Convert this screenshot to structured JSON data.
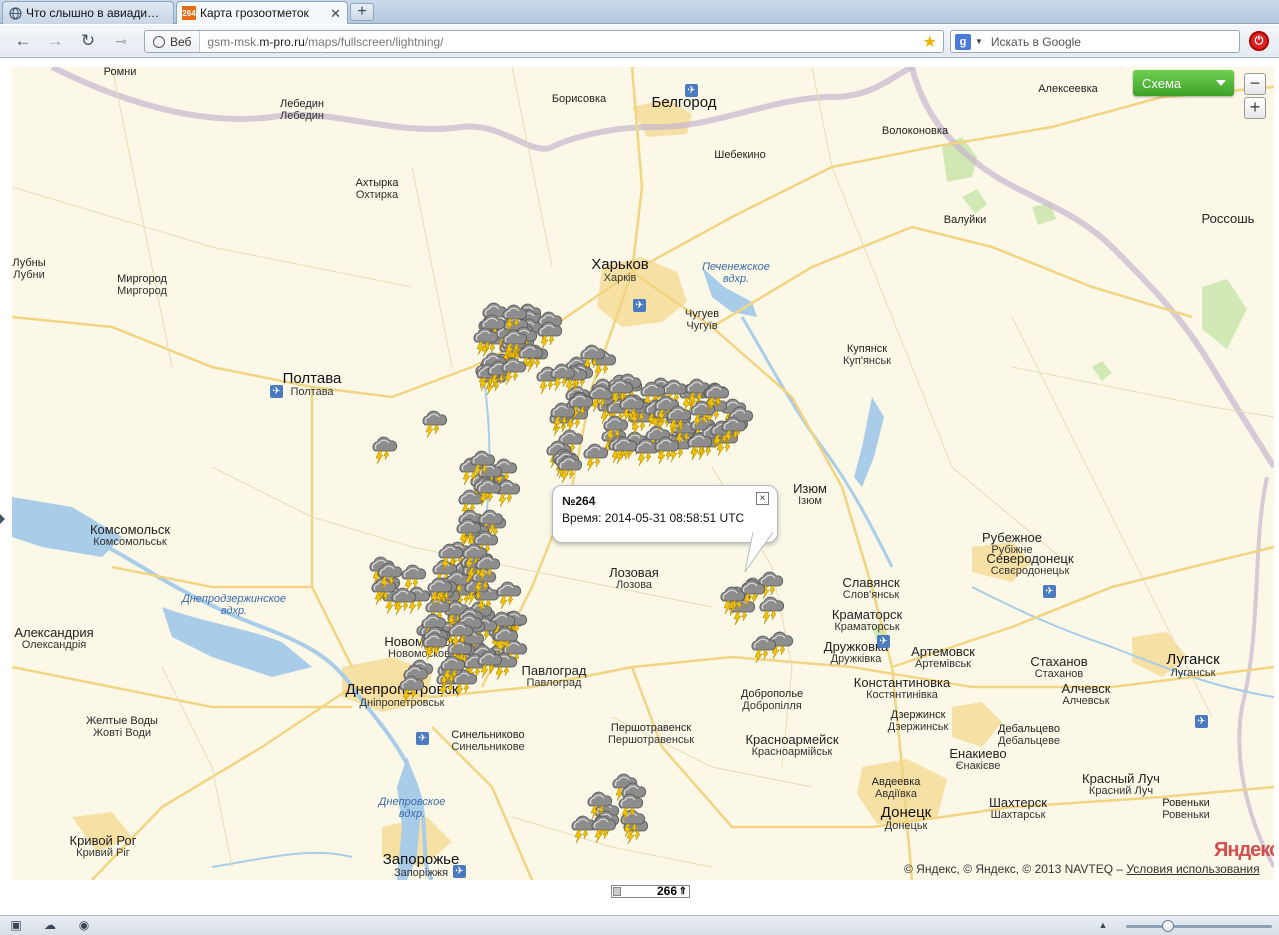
{
  "browser": {
    "tabs": [
      {
        "label": "Что слышно в авиади…",
        "favicon": "globe-icon",
        "active": false
      },
      {
        "label": "Карта грозоотметок",
        "favicon": "264",
        "active": true
      }
    ],
    "new_tab": "+",
    "address": {
      "badge": "Веб",
      "url_prefix": "gsm-msk.",
      "url_domain": "m-pro.ru",
      "url_path": "/maps/fullscreen/lightning/"
    },
    "search": {
      "engine": "g",
      "placeholder": "Искать в Google"
    }
  },
  "map": {
    "layer_button": "Схема",
    "zoom_out": "−",
    "zoom_in": "+",
    "popup": {
      "title": "№264",
      "time_label": "Время:",
      "time_value": "2014-05-31 08:58:51 UTC",
      "close": "×"
    },
    "copyright_text": "© Яндекс, © Яндекс, © 2013 NAVTEQ –",
    "terms_link": "Условия использования",
    "logo": "Яндекс",
    "counter": "266",
    "cities": [
      {
        "n": "Ромни",
        "s": "",
        "c": "sm"
      },
      {
        "n": "Борисовка",
        "s": "",
        "c": "sm"
      },
      {
        "n": "Белгород",
        "s": "",
        "c": "big"
      },
      {
        "n": "Алексеевка",
        "s": "",
        "c": "sm"
      },
      {
        "n": "Лебедин",
        "s": "Лебедин",
        "c": "sm"
      },
      {
        "n": "Волоконовка",
        "s": "",
        "c": "sm"
      },
      {
        "n": "Шебекино",
        "s": "",
        "c": "sm"
      },
      {
        "n": "Ахтырка",
        "s": "Охтирка",
        "c": "sm"
      },
      {
        "n": "Валуйки",
        "s": "",
        "c": "sm"
      },
      {
        "n": "Россошь",
        "s": "",
        "c": "med"
      },
      {
        "n": "Лубны",
        "s": "Лубни",
        "c": "sm"
      },
      {
        "n": "Миргород",
        "s": "Миргород",
        "c": "sm"
      },
      {
        "n": "Харьков",
        "s": "Харків",
        "c": "big"
      },
      {
        "n": "Чугуев",
        "s": "Чугуїв",
        "c": "sm"
      },
      {
        "n": "Купянск",
        "s": "Куп'янськ",
        "c": "sm"
      },
      {
        "n": "Полтава",
        "s": "Полтава",
        "c": "big"
      },
      {
        "n": "Изюм",
        "s": "Ізюм",
        "c": "med"
      },
      {
        "n": "Комсомольск",
        "s": "Комсомольськ",
        "c": "med"
      },
      {
        "n": "Рубежное",
        "s": "Рубіжне",
        "c": "med"
      },
      {
        "n": "Северодонецк",
        "s": "Сєвєродонецьк",
        "c": "med"
      },
      {
        "n": "Лозовая",
        "s": "Лозова",
        "c": "med"
      },
      {
        "n": "Славянск",
        "s": "Слов'янськ",
        "c": "med"
      },
      {
        "n": "Краматорск",
        "s": "Краматорськ",
        "c": "med"
      },
      {
        "n": "Александрия",
        "s": "Олександрія",
        "c": "med"
      },
      {
        "n": "Новомосковск",
        "s": "Новомосковськ",
        "c": "med"
      },
      {
        "n": "Дружковка",
        "s": "Дружківка",
        "c": "med"
      },
      {
        "n": "Артемовск",
        "s": "Артемівськ",
        "c": "med"
      },
      {
        "n": "Стаханов",
        "s": "Стаханов",
        "c": "med"
      },
      {
        "n": "Луганск",
        "s": "Луганськ",
        "c": "big"
      },
      {
        "n": "Павлоград",
        "s": "Павлоград",
        "c": "med"
      },
      {
        "n": "Константиновка",
        "s": "Костянтинівка",
        "c": "med"
      },
      {
        "n": "Алчевск",
        "s": "Алчевськ",
        "c": "med"
      },
      {
        "n": "Днепропетровск",
        "s": "Дніпропетровськ",
        "c": "big"
      },
      {
        "n": "Доброполье",
        "s": "Добропілля",
        "c": "sm"
      },
      {
        "n": "Дзержинск",
        "s": "Дзержинськ",
        "c": "sm"
      },
      {
        "n": "Желтые Воды",
        "s": "Жовті Води",
        "c": "sm"
      },
      {
        "n": "Дебальцево",
        "s": "Дебальцеве",
        "c": "sm"
      },
      {
        "n": "Синельниково",
        "s": "Синельникове",
        "c": "sm"
      },
      {
        "n": "Першотравенск",
        "s": "Першотравенськ",
        "c": "sm"
      },
      {
        "n": "Красноармейск",
        "s": "Красноармійськ",
        "c": "med"
      },
      {
        "n": "Енакиево",
        "s": "Єнакієве",
        "c": "med"
      },
      {
        "n": "Авдеевка",
        "s": "Авдіївка",
        "c": "sm"
      },
      {
        "n": "Красный Луч",
        "s": "Красний Луч",
        "c": "med"
      },
      {
        "n": "Шахтерск",
        "s": "Шахтарськ",
        "c": "med"
      },
      {
        "n": "Ровеньки",
        "s": "Ровеньки",
        "c": "sm"
      },
      {
        "n": "Донецк",
        "s": "Донецьк",
        "c": "big"
      },
      {
        "n": "Кривой Рог",
        "s": "Кривий Ріг",
        "c": "med"
      },
      {
        "n": "Запорожье",
        "s": "Запоріжжя",
        "c": "big"
      }
    ],
    "water_labels": [
      {
        "n": "Печенежское вдхр."
      },
      {
        "n": "Днепродзержинское вдхр."
      },
      {
        "n": "Днепровское вдхр."
      }
    ],
    "colors": {
      "water": "#a9cde8",
      "road": "#f2d482",
      "border": "#c6b7cf",
      "urban": "#f6e0a4",
      "forest": "#cde7b0",
      "land": "#fbf8e8",
      "storm_cloud": "#8d8d8d",
      "lightning": "#f5c400"
    }
  }
}
